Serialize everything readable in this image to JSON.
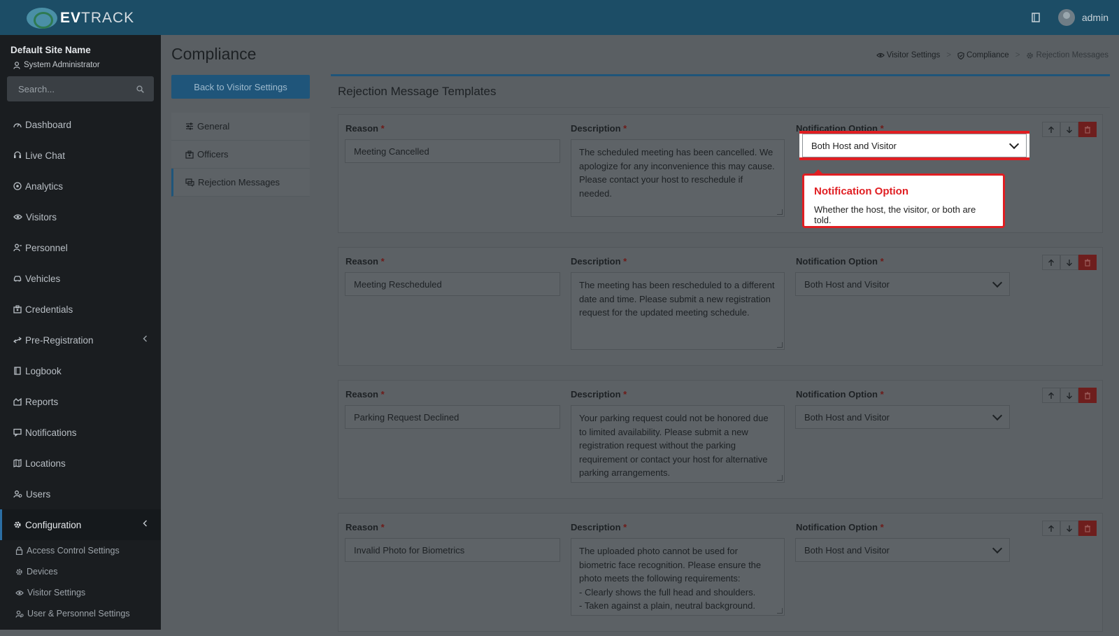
{
  "brand": {
    "logo_bold": "EV",
    "logo_rest": "TRACK"
  },
  "topbar": {
    "user": "admin"
  },
  "sidebar": {
    "site_name": "Default Site Name",
    "role": "System Administrator",
    "search_placeholder": "Search...",
    "items": [
      {
        "label": "Dashboard"
      },
      {
        "label": "Live Chat"
      },
      {
        "label": "Analytics"
      },
      {
        "label": "Visitors"
      },
      {
        "label": "Personnel"
      },
      {
        "label": "Vehicles"
      },
      {
        "label": "Credentials"
      },
      {
        "label": "Pre-Registration"
      },
      {
        "label": "Logbook"
      },
      {
        "label": "Reports"
      },
      {
        "label": "Notifications"
      },
      {
        "label": "Locations"
      },
      {
        "label": "Users"
      },
      {
        "label": "Configuration"
      }
    ],
    "subitems": [
      {
        "label": "Access Control Settings"
      },
      {
        "label": "Devices"
      },
      {
        "label": "Visitor Settings"
      },
      {
        "label": "User & Personnel Settings"
      }
    ]
  },
  "page": {
    "title": "Compliance",
    "back_button": "Back to Visitor Settings",
    "breadcrumb": [
      "Visitor Settings",
      "Compliance",
      "Rejection Messages"
    ],
    "tabs": [
      {
        "label": "General"
      },
      {
        "label": "Officers"
      },
      {
        "label": "Rejection Messages"
      }
    ]
  },
  "panel": {
    "title": "Rejection Message Templates",
    "labels": {
      "reason": "Reason",
      "description": "Description",
      "notification": "Notification Option",
      "required_mark": "*"
    },
    "cards": [
      {
        "reason": "Meeting Cancelled",
        "description": "The scheduled meeting has been cancelled. We apologize for any inconvenience this may cause. Please contact your host to reschedule if needed.",
        "notification": "Both Host and Visitor"
      },
      {
        "reason": "Meeting Rescheduled",
        "description": "The meeting has been rescheduled to a different date and time. Please submit a new registration request for the updated meeting schedule.",
        "notification": "Both Host and Visitor"
      },
      {
        "reason": "Parking Request Declined",
        "description": "Your parking request could not be honored due to limited availability. Please submit a new registration request without the parking requirement or contact your host for alternative parking arrangements.",
        "notification": "Both Host and Visitor"
      },
      {
        "reason": "Invalid Photo for Biometrics",
        "description": "The uploaded photo cannot be used for biometric face recognition. Please ensure the photo meets the following requirements:\n- Clearly shows the full head and shoulders.\n- Taken against a plain, neutral background.",
        "notification": "Both Host and Visitor"
      }
    ]
  },
  "tooltip": {
    "title": "Notification Option",
    "body": "Whether the host, the visitor, or both are told."
  },
  "colors": {
    "highlight": "#e01e22",
    "primary": "#1f557a",
    "danger": "#6e1e1d"
  }
}
